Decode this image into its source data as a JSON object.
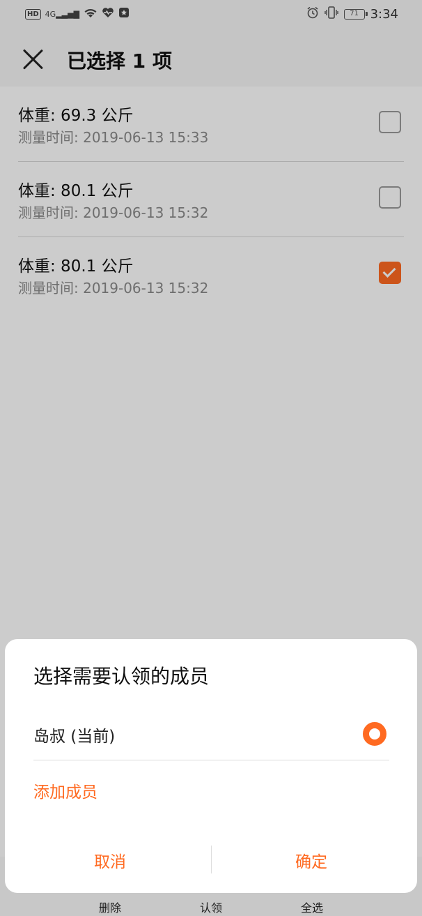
{
  "status_bar": {
    "hd_badge": "HD",
    "network": "4G",
    "battery": "71",
    "time": "3:34",
    "icons": [
      "hd-icon",
      "signal-icon",
      "wifi-icon",
      "health-icon",
      "notification-icon",
      "alarm-icon",
      "vibrate-icon",
      "battery-icon"
    ]
  },
  "header": {
    "title": "已选择 1 项"
  },
  "records": [
    {
      "weight": "体重: 69.3 公斤",
      "time": "测量时间: 2019-06-13 15:33",
      "checked": false
    },
    {
      "weight": "体重: 80.1 公斤",
      "time": "测量时间: 2019-06-13 15:32",
      "checked": false
    },
    {
      "weight": "体重: 80.1 公斤",
      "time": "测量时间: 2019-06-13 15:32",
      "checked": true
    }
  ],
  "bottom_bar": {
    "delete_label": "删除",
    "claim_label": "认领",
    "select_all_label": "全选"
  },
  "dialog": {
    "title": "选择需要认领的成员",
    "member_name": "岛叔 (当前)",
    "member_selected": true,
    "add_member_label": "添加成员",
    "cancel_label": "取消",
    "confirm_label": "确定"
  },
  "colors": {
    "accent": "#ff6a21",
    "overlay": "rgba(0,0,0,0.2)"
  }
}
